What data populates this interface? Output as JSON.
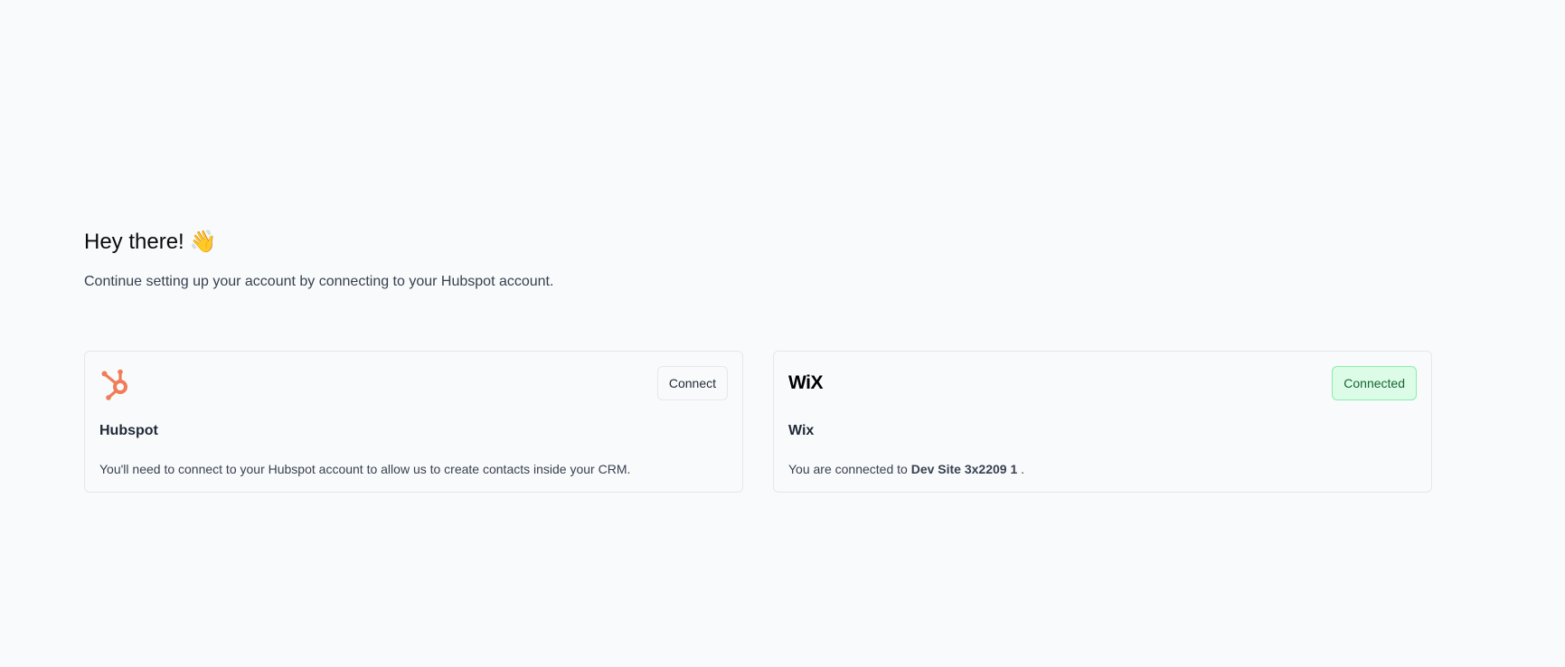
{
  "greeting": {
    "title": "Hey there!",
    "emoji": "👋",
    "subtitle": "Continue setting up your account by connecting to your Hubspot account."
  },
  "cards": [
    {
      "logo_icon": "hubspot-icon",
      "logo_color": "#ef7d58",
      "button_label": "Connect",
      "title": "Hubspot",
      "description": "You'll need to connect to your Hubspot account to allow us to create contacts inside your CRM."
    },
    {
      "logo_icon": "wix-logo",
      "logo_text": "WiX",
      "button_label": "Connected",
      "button_bg": "#dcfce7",
      "button_border": "#86efac",
      "button_text_color": "#166534",
      "title": "Wix",
      "description_prefix": "You are connected to",
      "site_name": "Dev Site 3x2209 1",
      "description_suffix": "."
    }
  ]
}
